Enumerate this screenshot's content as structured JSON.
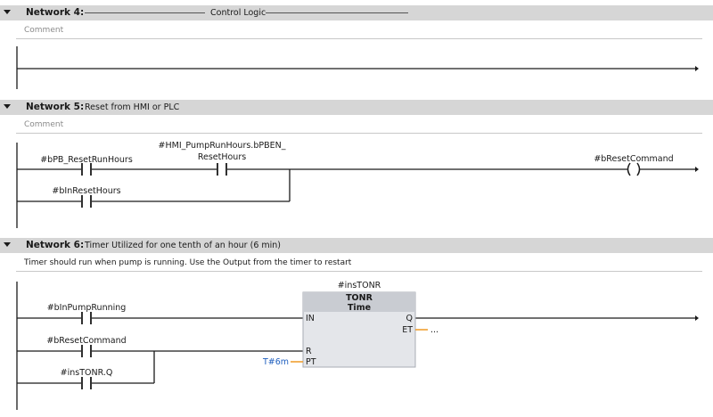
{
  "networks": [
    {
      "title": "Network 4:",
      "description": "Control Logic",
      "comment": "Comment"
    },
    {
      "title": "Network 5:",
      "description": "Reset from HMI or PLC",
      "comment": "Comment",
      "contacts": {
        "reset_run_hours": "#bPB_ResetRunHours",
        "hmi_bit_line1": "#HMI_PumpRunHours.bPBEN_",
        "hmi_bit_line2": "ResetHours",
        "in_reset_hours": "#bInResetHours"
      },
      "coil": "#bResetCommand"
    },
    {
      "title": "Network 6:",
      "description": "Timer Utilized for one tenth of an hour (6 min)",
      "comment": "Timer should run when pump is running. Use the Output from the timer to restart",
      "contacts": {
        "pump_running": "#bInPumpRunning",
        "reset_command": "#bResetCommand",
        "tonr_q": "#insTONR.Q"
      },
      "timer": {
        "instance": "#insTONR",
        "type": "TONR",
        "subtype": "Time",
        "pin_in": "IN",
        "pin_r": "R",
        "pin_pt": "PT",
        "pin_q": "Q",
        "pin_et": "ET",
        "pt_value": "T#6m",
        "et_value": "..."
      }
    }
  ],
  "colors": {
    "header_bg": "#d6d6d6",
    "wire": "#1a1a1a",
    "block_bg": "#e4e6ea",
    "block_header": "#c9ccd2",
    "pin_wire": "#f0a030",
    "constant": "#1f5fbf"
  }
}
